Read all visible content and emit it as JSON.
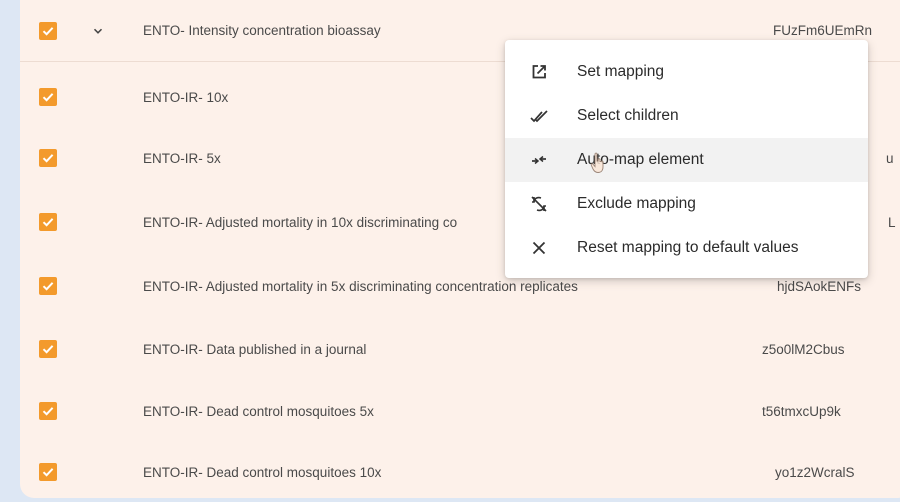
{
  "rows": [
    {
      "name": "ENTO- Intensity concentration bioassay",
      "id": "FUzFm6UEmRn",
      "checked": true,
      "expandable": true
    },
    {
      "name": "ENTO-IR- 10x",
      "id": "",
      "checked": true
    },
    {
      "name": "ENTO-IR- 5x",
      "id": "u",
      "checked": true
    },
    {
      "name": "ENTO-IR- Adjusted mortality in 10x discriminating co",
      "id": "L",
      "checked": true
    },
    {
      "name": "ENTO-IR- Adjusted mortality in 5x discriminating concentration replicates",
      "id": "hjdSAokENFs",
      "checked": true
    },
    {
      "name": "ENTO-IR- Data published in a journal",
      "id": "z5o0lM2Cbus",
      "checked": true
    },
    {
      "name": "ENTO-IR- Dead control mosquitoes 5x",
      "id": "t56tmxcUp9k",
      "checked": true
    },
    {
      "name": "ENTO-IR- Dead control mosquitoes 10x",
      "id": "yo1z2WcralS",
      "checked": true
    }
  ],
  "menu": {
    "items": [
      {
        "label": "Set mapping",
        "icon": "edit-icon"
      },
      {
        "label": "Select children",
        "icon": "double-check-icon"
      },
      {
        "label": "Auto-map element",
        "icon": "auto-map-icon"
      },
      {
        "label": "Exclude mapping",
        "icon": "exclude-icon"
      },
      {
        "label": "Reset mapping to default values",
        "icon": "close-icon"
      }
    ]
  },
  "colors": {
    "checkbox": "#f39a2c",
    "panel": "#fdf1ea",
    "background": "#dde7f4"
  }
}
